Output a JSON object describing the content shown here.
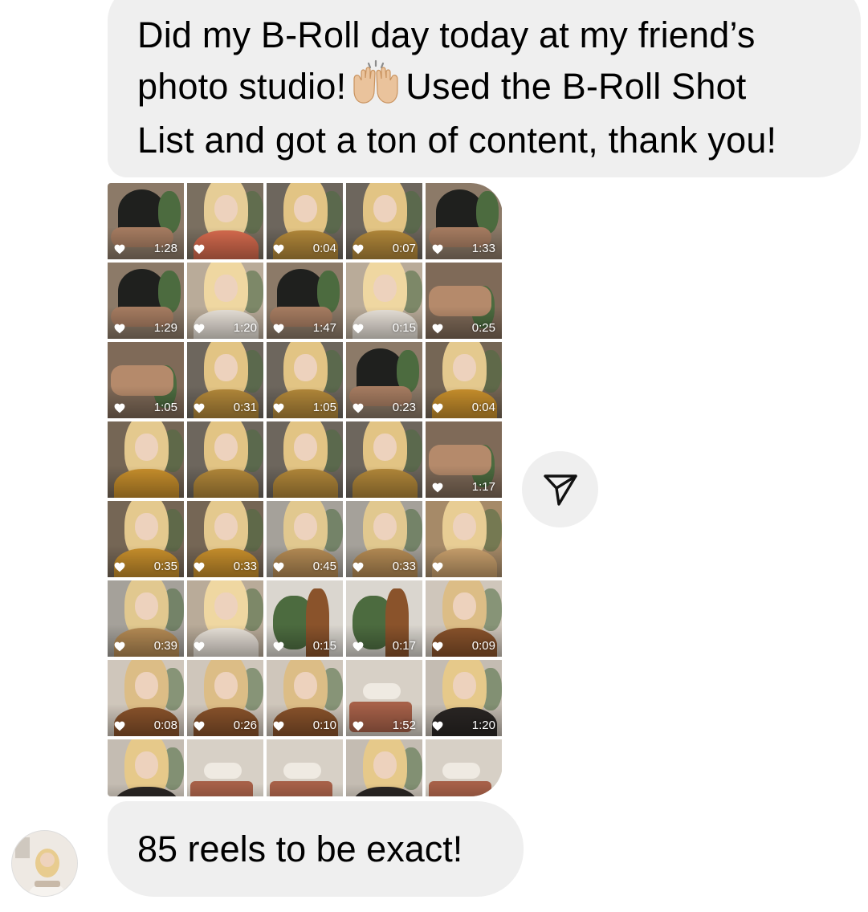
{
  "thread": {
    "message_1": {
      "line_1": "Did my B-Roll day today at my friend’s",
      "line_2_before_emoji": "photo studio!",
      "emoji": "raising-hands-emoji",
      "line_2_after_emoji": "Used the B-Roll Shot",
      "line_3": "List and got a ton of content, thank you!"
    },
    "shared_grid": {
      "tiles": [
        {
          "duration": "1:28",
          "liked": true,
          "scene": "room"
        },
        {
          "duration": "",
          "liked": true,
          "scene": "person-flowers"
        },
        {
          "duration": "0:04",
          "liked": true,
          "scene": "person"
        },
        {
          "duration": "0:07",
          "liked": true,
          "scene": "person"
        },
        {
          "duration": "1:33",
          "liked": true,
          "scene": "room"
        },
        {
          "duration": "1:29",
          "liked": true,
          "scene": "room"
        },
        {
          "duration": "1:20",
          "liked": true,
          "scene": "person-light"
        },
        {
          "duration": "1:47",
          "liked": true,
          "scene": "room"
        },
        {
          "duration": "0:15",
          "liked": true,
          "scene": "person-light"
        },
        {
          "duration": "0:25",
          "liked": true,
          "scene": "sofa"
        },
        {
          "duration": "1:05",
          "liked": true,
          "scene": "sofa"
        },
        {
          "duration": "0:31",
          "liked": true,
          "scene": "person"
        },
        {
          "duration": "1:05",
          "liked": true,
          "scene": "person"
        },
        {
          "duration": "0:23",
          "liked": true,
          "scene": "room"
        },
        {
          "duration": "0:04",
          "liked": true,
          "scene": "person-mustard"
        },
        {
          "duration": "",
          "liked": false,
          "scene": "person-mustard"
        },
        {
          "duration": "",
          "liked": false,
          "scene": "person"
        },
        {
          "duration": "",
          "liked": false,
          "scene": "person"
        },
        {
          "duration": "",
          "liked": false,
          "scene": "person"
        },
        {
          "duration": "1:17",
          "liked": true,
          "scene": "sofa"
        },
        {
          "duration": "0:35",
          "liked": true,
          "scene": "person-mustard"
        },
        {
          "duration": "0:33",
          "liked": true,
          "scene": "person-mustard"
        },
        {
          "duration": "0:45",
          "liked": true,
          "scene": "window"
        },
        {
          "duration": "0:33",
          "liked": true,
          "scene": "window"
        },
        {
          "duration": "",
          "liked": true,
          "scene": "mirror"
        },
        {
          "duration": "0:39",
          "liked": true,
          "scene": "window"
        },
        {
          "duration": "",
          "liked": true,
          "scene": "person-light"
        },
        {
          "duration": "0:15",
          "liked": true,
          "scene": "plant"
        },
        {
          "duration": "0:17",
          "liked": true,
          "scene": "plant"
        },
        {
          "duration": "0:09",
          "liked": true,
          "scene": "person-brown"
        },
        {
          "duration": "0:08",
          "liked": true,
          "scene": "person-brown"
        },
        {
          "duration": "0:26",
          "liked": true,
          "scene": "person-brown"
        },
        {
          "duration": "0:10",
          "liked": true,
          "scene": "person-brown"
        },
        {
          "duration": "1:52",
          "liked": true,
          "scene": "bed"
        },
        {
          "duration": "1:20",
          "liked": true,
          "scene": "person-dark"
        },
        {
          "duration": "",
          "liked": false,
          "scene": "person-dark"
        },
        {
          "duration": "",
          "liked": false,
          "scene": "bed"
        },
        {
          "duration": "",
          "liked": false,
          "scene": "bed"
        },
        {
          "duration": "",
          "liked": false,
          "scene": "person-dark"
        },
        {
          "duration": "",
          "liked": false,
          "scene": "bed"
        }
      ]
    },
    "share_button_icon": "paper-plane-icon",
    "message_2": {
      "text": "85 reels to be exact!"
    },
    "sender_avatar": "avatar"
  },
  "colors": {
    "bubble_bg": "#efefef",
    "text": "#000000",
    "overlay_text": "#ffffff"
  }
}
